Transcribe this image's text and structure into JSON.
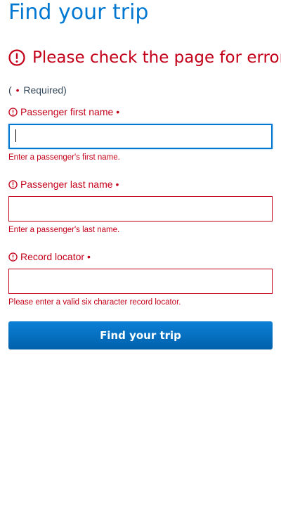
{
  "page": {
    "title": "Find your trip"
  },
  "error_banner": {
    "icon": "alert-circle-icon",
    "text": "Please check the page for errors",
    "color": "#c30019"
  },
  "required_note": {
    "open": "(",
    "dot": "•",
    "text": "Required)"
  },
  "fields": [
    {
      "label": "Passenger first name",
      "required_mark": "•",
      "value": "",
      "error": "Enter a passenger's first name.",
      "focused": true
    },
    {
      "label": "Passenger last name",
      "required_mark": "•",
      "value": "",
      "error": "Enter a passenger's last name.",
      "focused": false
    },
    {
      "label": "Record locator",
      "required_mark": "•",
      "value": "",
      "error": "Please enter a valid six character record locator.",
      "focused": false
    }
  ],
  "submit": {
    "label": "Find your trip"
  },
  "colors": {
    "brand_blue": "#0078d2",
    "error_red": "#c30019",
    "text_dark": "#36495a"
  }
}
